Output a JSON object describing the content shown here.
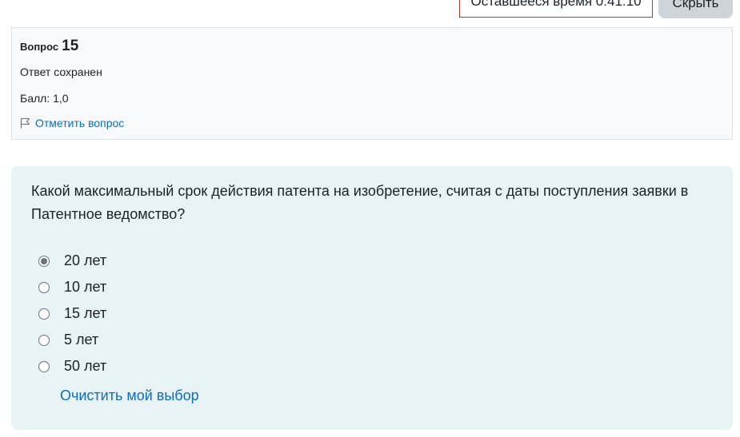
{
  "header": {
    "timer_text": "Оставшееся время 0:41:10",
    "hide_label": "Скрыть"
  },
  "info": {
    "question_label": "Вопрос",
    "question_number": "15",
    "state": "Ответ сохранен",
    "grade": "Балл: 1,0",
    "flag_label": "Отметить вопрос"
  },
  "question": {
    "text": "Какой максимальный срок действия патента на изобретение, считая с даты поступления заявки в Патентное ведомство?",
    "answers": [
      {
        "label": "20 лет",
        "checked": true
      },
      {
        "label": "10 лет",
        "checked": false
      },
      {
        "label": "15 лет",
        "checked": false
      },
      {
        "label": "5 лет",
        "checked": false
      },
      {
        "label": "50 лет",
        "checked": false
      }
    ],
    "clear_label": "Очистить мой выбор"
  }
}
